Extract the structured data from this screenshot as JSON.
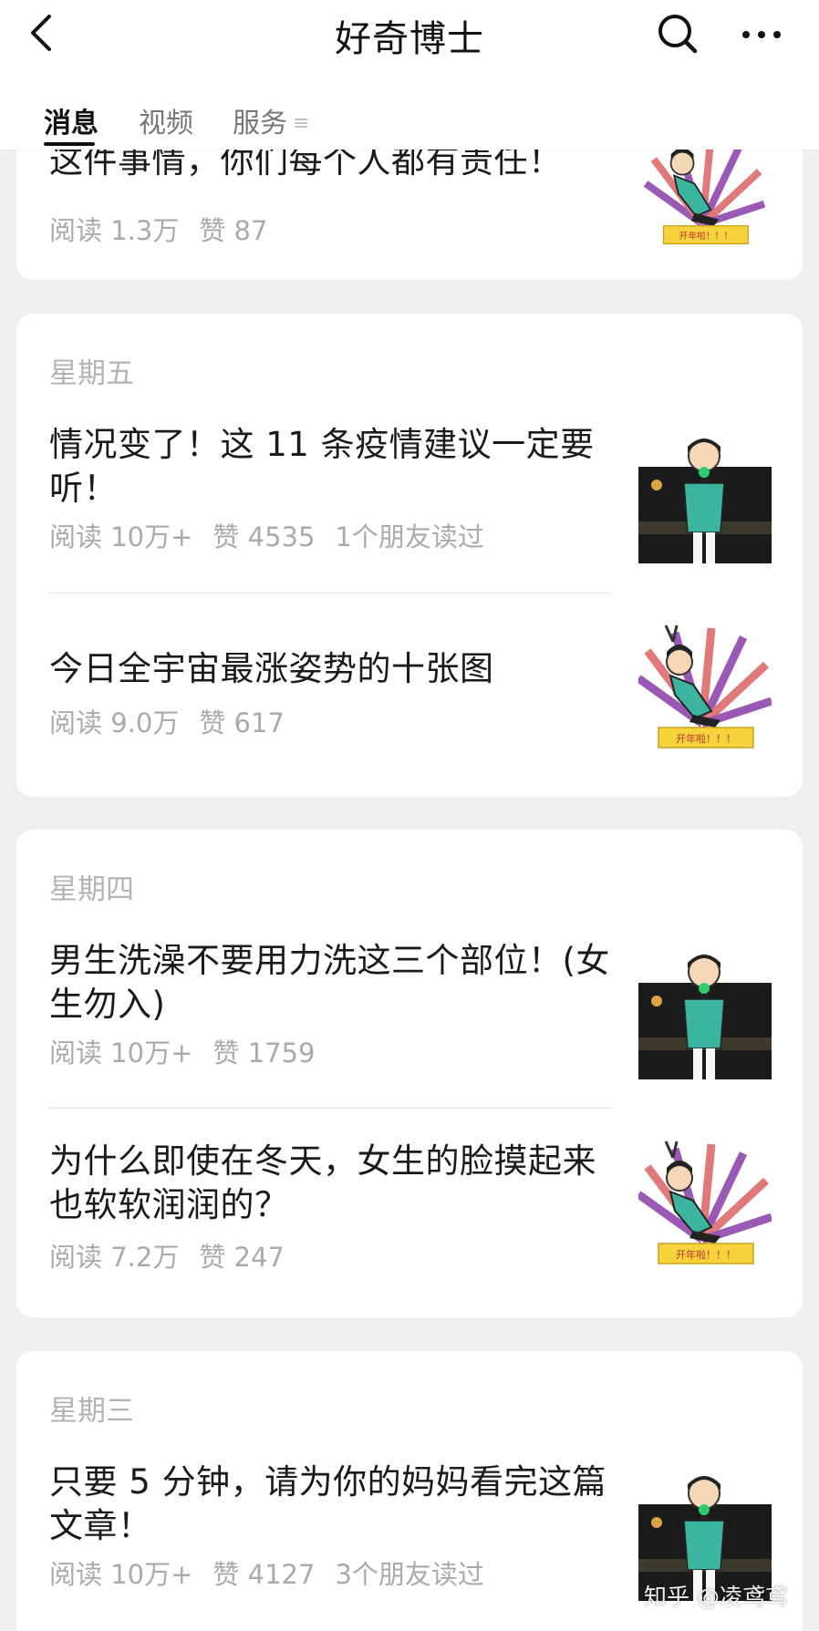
{
  "header": {
    "title": "好奇博士",
    "tabs": [
      {
        "label": "消息",
        "active": true
      },
      {
        "label": "视频",
        "active": false
      },
      {
        "label": "服务",
        "active": false
      }
    ]
  },
  "cards": [
    {
      "articles": [
        {
          "title": "这件事情，你们每个人都有责任！",
          "reads": "阅读 1.3万",
          "likes": "赞 87",
          "friends": "",
          "thumb": "dancing-cartoon"
        }
      ]
    },
    {
      "day": "星期五",
      "articles": [
        {
          "title": "情况变了！这 11 条疫情建议一定要听！",
          "reads": "阅读 10万+",
          "likes": "赞 4535",
          "friends": "1个朋友读过",
          "thumb": "microphone-cartoon"
        },
        {
          "title": "今日全宇宙最涨姿势的十张图",
          "reads": "阅读 9.0万",
          "likes": "赞 617",
          "friends": "",
          "thumb": "dancing-cartoon"
        }
      ]
    },
    {
      "day": "星期四",
      "articles": [
        {
          "title": "男生洗澡不要用力洗这三个部位！(女生勿入)",
          "reads": "阅读 10万+",
          "likes": "赞 1759",
          "friends": "",
          "thumb": "microphone-cartoon"
        },
        {
          "title": "为什么即使在冬天，女生的脸摸起来也软软润润的？",
          "reads": "阅读 7.2万",
          "likes": "赞 247",
          "friends": "",
          "thumb": "dancing-cartoon"
        }
      ]
    },
    {
      "day": "星期三",
      "articles": [
        {
          "title": "只要 5 分钟，请为你的妈妈看完这篇文章！",
          "reads": "阅读 10万+",
          "likes": "赞 4127",
          "friends": "3个朋友读过",
          "thumb": "microphone-cartoon"
        }
      ]
    }
  ],
  "watermark": "知乎 @凌鸢鸢",
  "colors": {
    "background": "#efefef",
    "card": "#ffffff",
    "meta_text": "#aaaaaa",
    "day_label": "#b3b3b3",
    "banner_yellow": "#f6d23c"
  }
}
